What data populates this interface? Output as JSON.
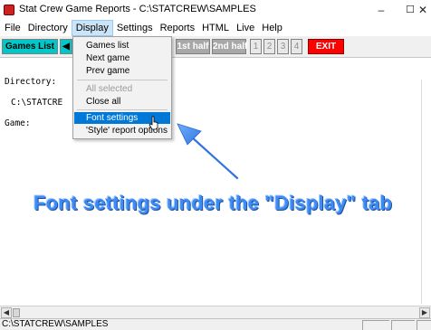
{
  "window": {
    "title": "Stat Crew Game Reports - C:\\STATCREW\\SAMPLES",
    "minimize": "–",
    "maximize": "☐",
    "close": "✕"
  },
  "menubar": {
    "items": [
      {
        "label": "File"
      },
      {
        "label": "Directory"
      },
      {
        "label": "Display",
        "active": true
      },
      {
        "label": "Settings"
      },
      {
        "label": "Reports"
      },
      {
        "label": "HTML"
      },
      {
        "label": "Live"
      },
      {
        "label": "Help"
      }
    ]
  },
  "toolbar": {
    "games_list": "Games List",
    "arrow": "◀",
    "first_half": "1st half",
    "second_half": "2nd half",
    "periods": [
      "1",
      "2",
      "3",
      "4"
    ],
    "exit": "EXIT"
  },
  "display_menu": {
    "items": [
      {
        "label": "Games list"
      },
      {
        "label": "Next game"
      },
      {
        "label": "Prev game"
      },
      {
        "label": "All selected",
        "disabled": true
      },
      {
        "label": "Close all"
      },
      {
        "label": "Font settings",
        "highlighted": true
      },
      {
        "label": "'Style' report options"
      }
    ]
  },
  "main": {
    "directory_label": "Directory:",
    "directory_value": "C:\\STATCRE",
    "game_label": "Game:"
  },
  "annotation": {
    "text": "Font settings under the \"Display\" tab",
    "color": "#3d8bf5"
  },
  "statusbar": {
    "path": "C:\\STATCREW\\SAMPLES"
  },
  "scroll": {
    "left_arrow": "◀",
    "right_arrow": "▶"
  }
}
